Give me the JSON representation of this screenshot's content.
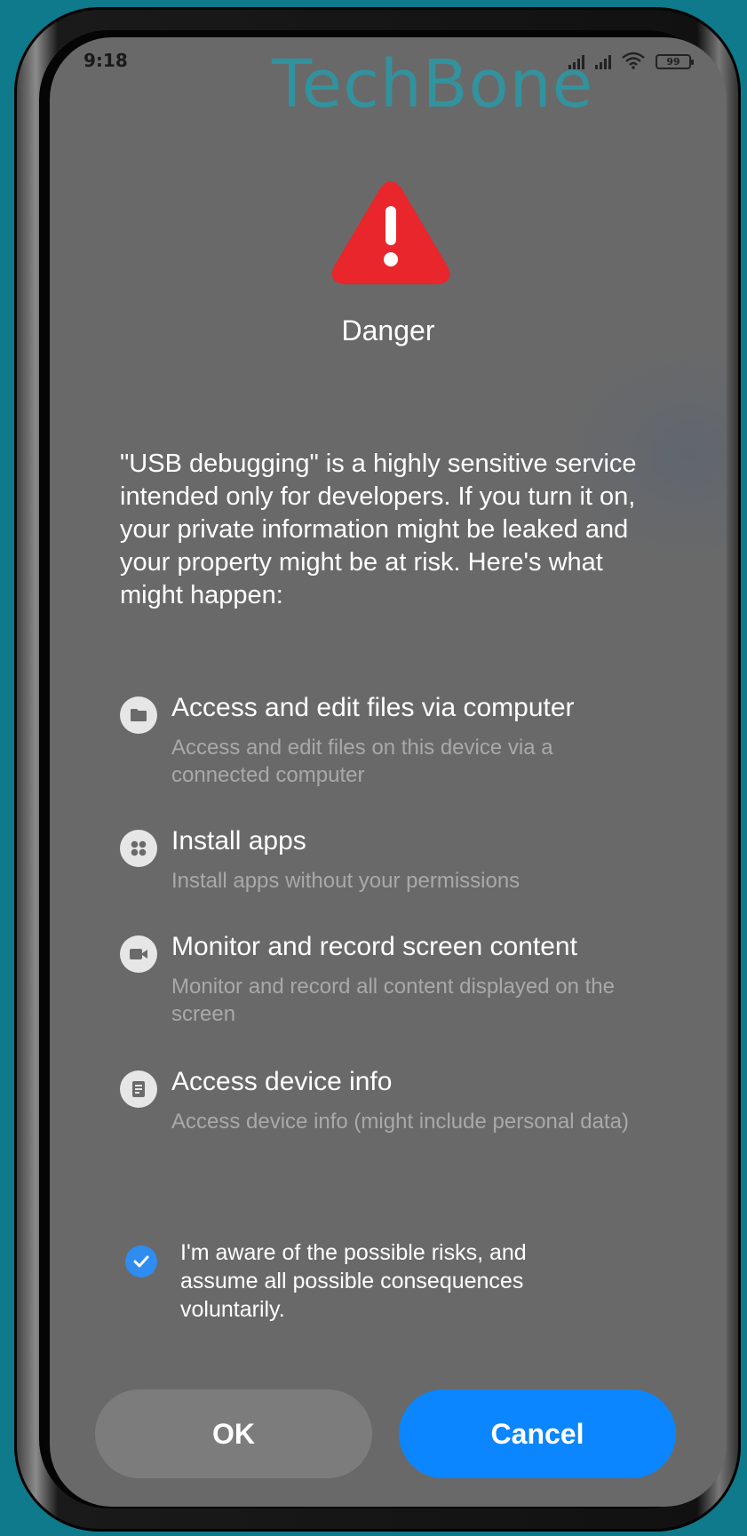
{
  "status_bar": {
    "time": "9:18",
    "battery": "99"
  },
  "watermark": "TechBone",
  "dialog": {
    "icon": "warning-triangle-icon",
    "title": "Danger",
    "description": "\"USB debugging\" is a highly sensitive service intended only for developers. If you turn it on, your private information might be leaked and your property might be at risk. Here's what might happen:",
    "permissions": [
      {
        "icon": "folder-icon",
        "title": "Access and edit files via computer",
        "description": "Access and edit files on this device via a connected computer"
      },
      {
        "icon": "apps-grid-icon",
        "title": "Install apps",
        "description": "Install apps without your permissions"
      },
      {
        "icon": "video-camera-icon",
        "title": "Monitor and record screen content",
        "description": "Monitor and record all content displayed on the screen"
      },
      {
        "icon": "document-icon",
        "title": "Access device info",
        "description": "Access device info (might include personal data)"
      }
    ],
    "consent": {
      "checked": true,
      "text": "I'm aware of the possible risks, and assume all possible consequences voluntarily."
    },
    "buttons": {
      "ok_label": "OK",
      "cancel_label": "Cancel"
    }
  },
  "colors": {
    "background": "#0e7a8c",
    "screen": "#696969",
    "warning_red": "#e8262b",
    "accent_blue": "#0b86ff",
    "checkbox_blue": "#2f8cf0",
    "secondary_text": "#a9a9a9",
    "watermark": "#2a9aa8"
  }
}
